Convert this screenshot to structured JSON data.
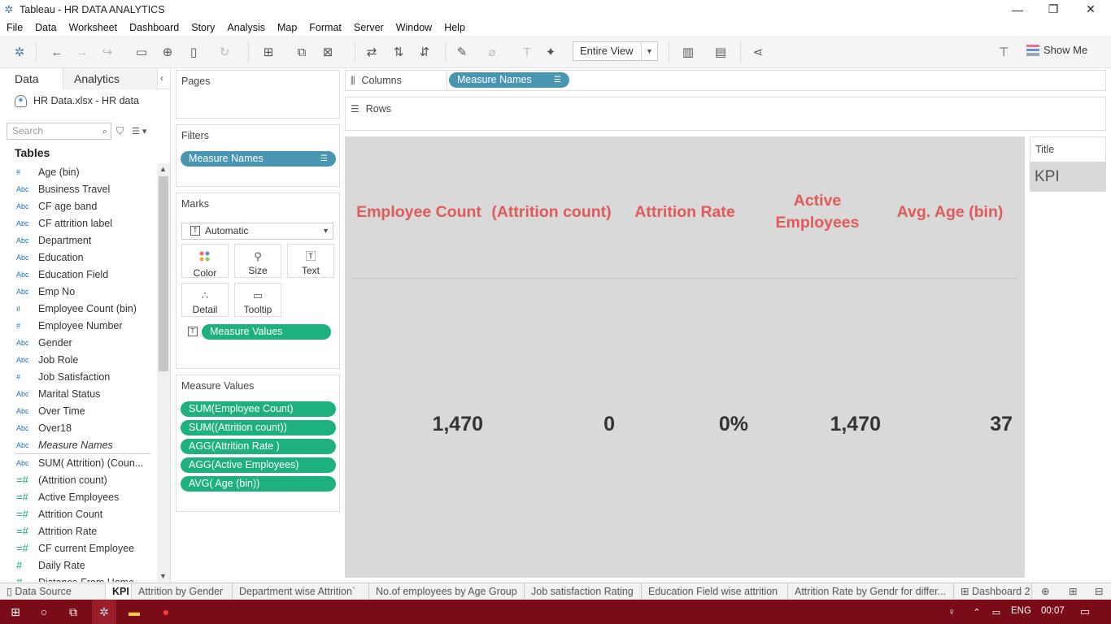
{
  "window": {
    "title": "Tableau - HR DATA ANALYTICS",
    "controls": {
      "minimize": "—",
      "restore": "❐",
      "close": "✕"
    }
  },
  "menu": [
    "File",
    "Data",
    "Worksheet",
    "Dashboard",
    "Story",
    "Analysis",
    "Map",
    "Format",
    "Server",
    "Window",
    "Help"
  ],
  "toolbar": {
    "view_mode": "Entire View",
    "show_me": "Show Me"
  },
  "data_pane": {
    "tabs": [
      "Data",
      "Analytics"
    ],
    "data_source": "HR Data.xlsx - HR data",
    "search_placeholder": "Search",
    "tables_header": "Tables",
    "fields": [
      {
        "type": "#",
        "kind": "dim",
        "name": "Age (bin)"
      },
      {
        "type": "Abc",
        "kind": "dim",
        "name": "Business Travel"
      },
      {
        "type": "Abc",
        "kind": "dim",
        "name": "CF age band"
      },
      {
        "type": "Abc",
        "kind": "dim",
        "name": "CF attrition label"
      },
      {
        "type": "Abc",
        "kind": "dim",
        "name": "Department"
      },
      {
        "type": "Abc",
        "kind": "dim",
        "name": "Education"
      },
      {
        "type": "Abc",
        "kind": "dim",
        "name": "Education Field"
      },
      {
        "type": "Abc",
        "kind": "dim",
        "name": "Emp No"
      },
      {
        "type": "ıl",
        "kind": "dim",
        "name": "Employee Count (bin)"
      },
      {
        "type": "#",
        "kind": "dim",
        "name": "Employee Number"
      },
      {
        "type": "Abc",
        "kind": "dim",
        "name": "Gender"
      },
      {
        "type": "Abc",
        "kind": "dim",
        "name": "Job Role"
      },
      {
        "type": "#",
        "kind": "dim",
        "name": "Job Satisfaction"
      },
      {
        "type": "Abc",
        "kind": "dim",
        "name": "Marital Status"
      },
      {
        "type": "Abc",
        "kind": "dim",
        "name": "Over Time"
      },
      {
        "type": "Abc",
        "kind": "dim",
        "name": "Over18"
      },
      {
        "type": "Abc",
        "kind": "dim",
        "name": "Measure Names",
        "italic": true
      },
      {
        "type": "Abc",
        "kind": "mea",
        "name": "SUM( Attrition) (Coun..."
      },
      {
        "type": "=#",
        "kind": "mea",
        "name": "(Attrition count)"
      },
      {
        "type": "=#",
        "kind": "mea",
        "name": "Active Employees"
      },
      {
        "type": "=#",
        "kind": "mea",
        "name": "Attrition Count"
      },
      {
        "type": "=#",
        "kind": "mea",
        "name": "Attrition Rate"
      },
      {
        "type": "=#",
        "kind": "mea",
        "name": "CF current Employee"
      },
      {
        "type": "#",
        "kind": "mea",
        "name": "Daily Rate"
      },
      {
        "type": "#",
        "kind": "mea",
        "name": "Distance From Home"
      }
    ]
  },
  "cards": {
    "pages": "Pages",
    "filters": "Filters",
    "filter_pill": "Measure Names",
    "marks": "Marks",
    "mark_type": "Automatic",
    "mark_buttons": [
      "Color",
      "Size",
      "Text",
      "Detail",
      "Tooltip"
    ],
    "marks_pill": "Measure Values",
    "measure_values": "Measure Values",
    "measure_pills": [
      "SUM(Employee Count)",
      "SUM((Attrition count))",
      "AGG(Attrition Rate )",
      "AGG(Active Employees)",
      "AVG( Age (bin))"
    ]
  },
  "shelves": {
    "columns_label": "Columns",
    "columns_pill": "Measure Names",
    "rows_label": "Rows"
  },
  "view": {
    "headers": [
      "Employee Count",
      "(Attrition count)",
      "Attrition Rate",
      "Active Employees",
      "Avg.  Age (bin)"
    ],
    "values": [
      "1,470",
      "0",
      "0%",
      "1,470",
      "37"
    ],
    "header_color": "#e05a5a",
    "background": "#d9d9d9"
  },
  "title_card": {
    "label": "Title",
    "value": "KPI"
  },
  "sheet_tabs": {
    "data_source": "Data Source",
    "sheets": [
      "KPI",
      "Attrition by Gender",
      "Department wise Attrition`",
      "No.of employees by Age Group",
      "Job satisfaction Rating",
      "Education Field wise attrition",
      "Attrition Rate by Gendr for differ...",
      "Dashboard 2"
    ]
  },
  "taskbar": {
    "lang": "ENG",
    "time": "00:07",
    "color": "#7a0c17"
  }
}
